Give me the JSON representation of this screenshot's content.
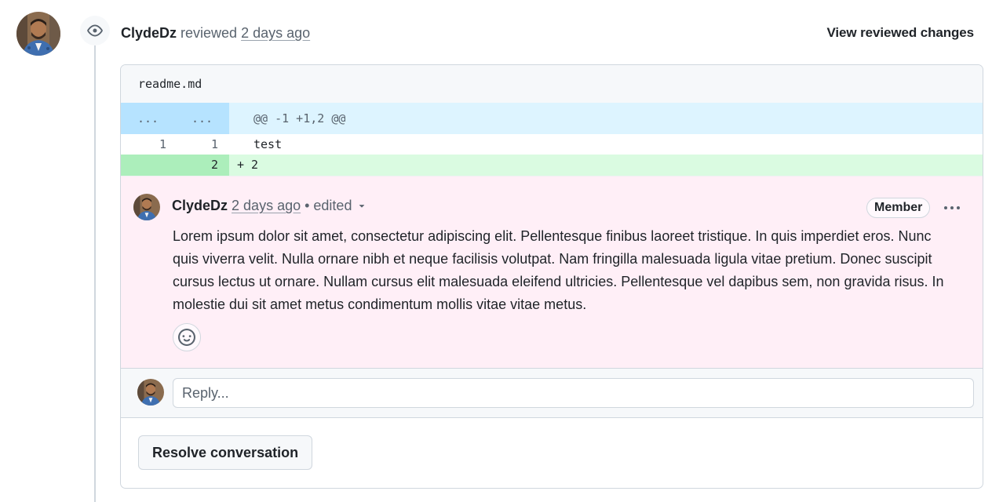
{
  "review": {
    "author": "ClydeDz",
    "action": " reviewed ",
    "time": "2 days ago",
    "view_changes": "View reviewed changes"
  },
  "file": {
    "name": "readme.md",
    "hunk": {
      "left": "...",
      "right": "...",
      "text": "@@ -1 +1,2 @@"
    },
    "lines": [
      {
        "left": "1",
        "right": "1",
        "text": "test"
      },
      {
        "left": "",
        "right": "2",
        "text": "+ 2"
      }
    ]
  },
  "comment": {
    "author": "ClydeDz",
    "time": "2 days ago",
    "edited": " • edited",
    "badge": "Member",
    "body": "Lorem ipsum dolor sit amet, consectetur adipiscing elit. Pellentesque finibus laoreet tristique. In quis imperdiet eros. Nunc quis viverra velit. Nulla ornare nibh et neque facilisis volutpat. Nam fringilla malesuada ligula vitae pretium. Donec suscipit cursus lectus ut ornare. Nullam cursus elit malesuada eleifend ultricies. Pellentesque vel dapibus sem, non gravida risus. In molestie dui sit amet metus condimentum mollis vitae vitae metus."
  },
  "reply": {
    "placeholder": "Reply..."
  },
  "resolve_label": "Resolve conversation",
  "icons": {
    "eye": "eye-icon",
    "caret": "triangle-down-icon",
    "kebab": "kebab-horizontal-icon",
    "emoji": "smiley-icon"
  },
  "colors": {
    "hunk_bg": "#ddf4ff",
    "hunk_num_bg": "#b6e3ff",
    "add_bg": "#dafbe1",
    "add_num_bg": "#aceebb",
    "comment_bg": "#ffeff7"
  }
}
